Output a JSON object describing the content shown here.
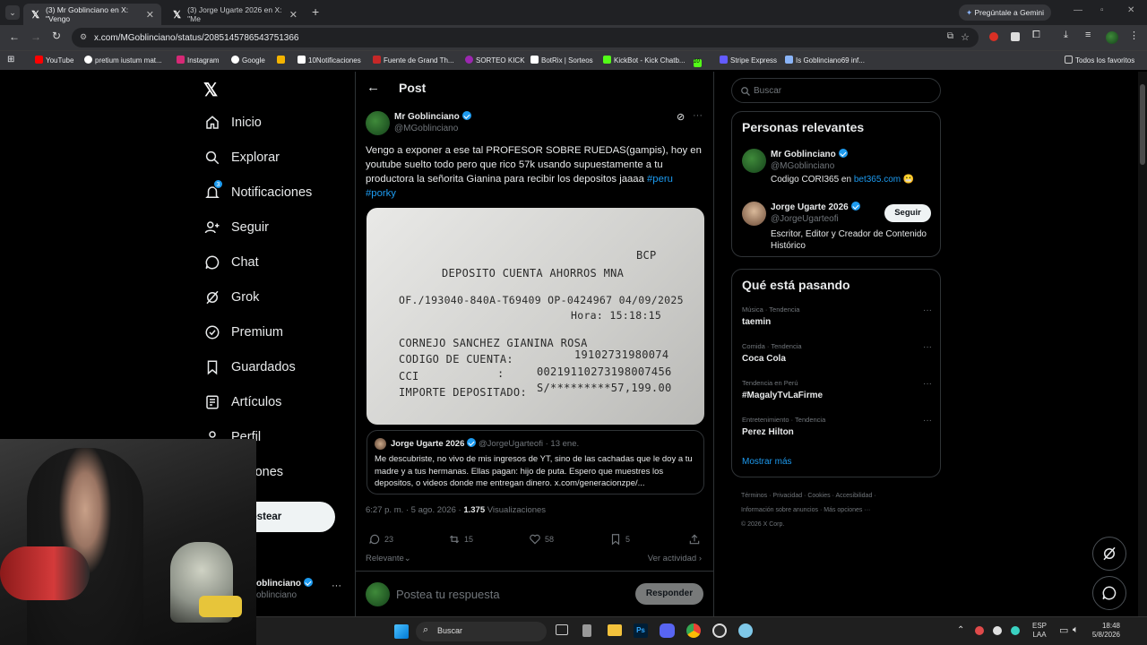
{
  "browser": {
    "tabs": [
      {
        "title": "(3) Mr Goblinciano en X: \"Vengo",
        "close": "✕"
      },
      {
        "title": "(3) Jorge Ugarte 2026 en X: \"Me",
        "close": "✕"
      }
    ],
    "gemini": "Pregúntale a Gemini",
    "url": "x.com/MGoblinciano/status/2085145786543751366",
    "bookmarks": [
      "YouTube",
      "pretium iustum mat...",
      "Instagram",
      "Google",
      "10Notificaciones",
      "Fuente de Grand Th...",
      "SORTEO KICK",
      "BotRix | Sorteos",
      "KickBot - Kick Chatb...",
      "10",
      "Stripe Express",
      "Is Goblinciano69 inf...",
      "Todos los favoritos"
    ]
  },
  "nav": {
    "items": [
      "Inicio",
      "Explorar",
      "Notificaciones",
      "Seguir",
      "Chat",
      "Grok",
      "Premium",
      "Guardados",
      "Artículos",
      "Perfil",
      "opciones"
    ],
    "badge": "3",
    "post_button": "ostear",
    "account_name": "oblinciano",
    "account_handle": "oblinciano"
  },
  "post": {
    "header": "Post",
    "author": "Mr Goblinciano",
    "handle": "@MGoblinciano",
    "text": "Vengo a exponer a ese tal PROFESOR SOBRE RUEDAS(gampis), hoy en youtube suelto todo pero que rico 57k usando supuestamente a tu productora la señorita Gianina para recibir los depositos jaaaa",
    "hashtags": [
      "#peru",
      "#porky"
    ],
    "receipt": {
      "bank": "BCP",
      "title": "DEPOSITO CUENTA AHORROS MNA",
      "line1": "OF./193040-840A-T69409 OP-0424967 04/09/2025",
      "hora": "Hora: 15:18:15",
      "name": "CORNEJO SANCHEZ GIANINA ROSA",
      "codigo_label": "CODIGO DE CUENTA:",
      "codigo": "19102731980074",
      "cci_label": "CCI",
      "cci_sep": ":",
      "cci": "00219110273198007456",
      "importe_label": "IMPORTE DEPOSITADO:",
      "importe": "S/*********57,199.00"
    },
    "quote": {
      "author": "Jorge Ugarte 2026",
      "handle": "@JorgeUgarteofi",
      "date": "· 13 ene.",
      "text": "Me descubriste, no vivo de mis ingresos de YT, sino de las cachadas que le doy a tu madre y a tus hermanas. Ellas pagan: hijo de puta. Espero que muestres los depositos, o videos donde me entregan dinero. x.com/generacionzpe/..."
    },
    "timestamp": "6:27 p. m. · 5 ago. 2026 ·",
    "views": "1.375",
    "views_label": "Visualizaciones",
    "replies": "23",
    "reposts": "15",
    "likes": "58",
    "bookmarks": "5",
    "sort": "Relevante",
    "activity": "Ver actividad",
    "reply_placeholder": "Postea tu respuesta",
    "reply_button": "Responder"
  },
  "sidebar": {
    "search_placeholder": "Buscar",
    "relevant_title": "Personas relevantes",
    "people": [
      {
        "name": "Mr Goblinciano",
        "handle": "@MGoblinciano",
        "bio_prefix": "Codigo CORI365 en",
        "bio_link": "bet365.com",
        "bio_emoji": "😬"
      },
      {
        "name": "Jorge Ugarte 2026",
        "handle": "@JorgeUgarteofi",
        "bio": "Escritor, Editor y Creador de Contenido Histórico",
        "follow": "Seguir"
      }
    ],
    "trending_title": "Qué está pasando",
    "trends": [
      {
        "category": "Música · Tendencia",
        "name": "taemin"
      },
      {
        "category": "Comida · Tendencia",
        "name": "Coca Cola"
      },
      {
        "category": "Tendencia en Perú",
        "name": "#MagalyTvLaFirme"
      },
      {
        "category": "Entretenimiento · Tendencia",
        "name": "Perez Hilton"
      }
    ],
    "show_more": "Mostrar más",
    "footer": [
      "Términos",
      "Privacidad",
      "Cookies",
      "Accesibilidad",
      "Información sobre anuncios",
      "Más opciones ···",
      "© 2026 X Corp."
    ]
  },
  "taskbar": {
    "search": "Buscar",
    "lang1": "ESP",
    "lang2": "LAA",
    "time": "18:48",
    "date": "5/8/2026"
  }
}
